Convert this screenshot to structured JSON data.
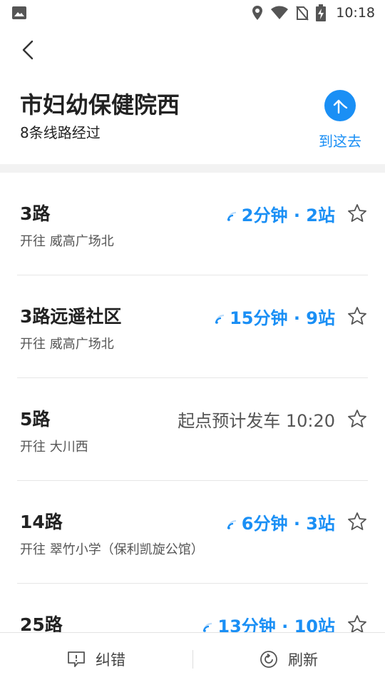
{
  "status_bar": {
    "time": "10:18",
    "icons": [
      "image-icon",
      "location-icon",
      "wifi-icon",
      "no-sim-icon",
      "battery-charging-icon"
    ]
  },
  "header": {
    "back_icon": "chevron-left-icon",
    "stop_name": "市妇幼保健院西",
    "line_count_text": "8条线路经过",
    "goto_label": "到这去",
    "goto_icon": "navigate-arrow-icon"
  },
  "colors": {
    "accent": "#1a8ff5",
    "text_primary": "#222222",
    "text_secondary": "#555555",
    "divider": "#e6e6e6"
  },
  "routes": [
    {
      "name": "3路",
      "destination": "开往 威高广场北",
      "eta": "2分钟 · 2站",
      "live": true
    },
    {
      "name": "3路远遥社区",
      "destination": "开往 威高广场北",
      "eta": "15分钟 · 9站",
      "live": true
    },
    {
      "name": "5路",
      "destination": "开往 大川西",
      "eta": "起点预计发车 10:20",
      "live": false
    },
    {
      "name": "14路",
      "destination": "开往 翠竹小学（保利凯旋公馆）",
      "eta": "6分钟 · 3站",
      "live": true
    },
    {
      "name": "25路",
      "destination": "",
      "eta": "13分钟 · 10站",
      "live": true
    }
  ],
  "bottom_bar": {
    "report_label": "纠错",
    "report_icon": "feedback-icon",
    "refresh_label": "刷新",
    "refresh_icon": "refresh-icon"
  }
}
